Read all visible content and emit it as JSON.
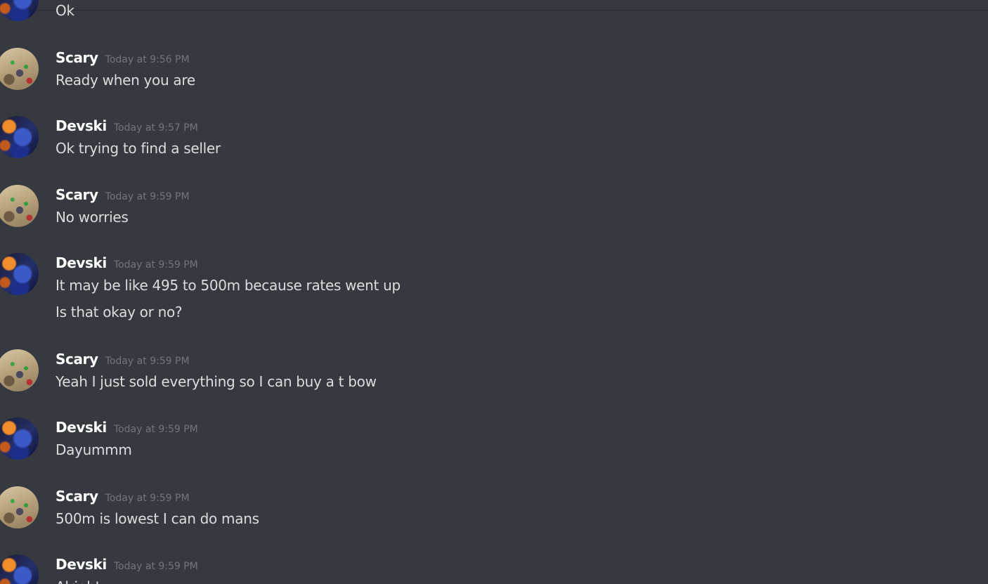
{
  "top_partial": {
    "text": "Ok"
  },
  "messages": [
    {
      "author": "Scary",
      "time": "Today at 9:56 PM",
      "lines": [
        "Ready when you are"
      ]
    },
    {
      "author": "Devski",
      "time": "Today at 9:57 PM",
      "lines": [
        "Ok trying to find a seller"
      ]
    },
    {
      "author": "Scary",
      "time": "Today at 9:59 PM",
      "lines": [
        "No worries"
      ]
    },
    {
      "author": "Devski",
      "time": "Today at 9:59 PM",
      "lines": [
        "It may be like 495 to 500m because rates went up",
        "Is that okay or no?"
      ]
    },
    {
      "author": "Scary",
      "time": "Today at 9:59 PM",
      "lines": [
        "Yeah I just sold everything so I can buy a t bow"
      ]
    },
    {
      "author": "Devski",
      "time": "Today at 9:59 PM",
      "lines": [
        "Dayummm"
      ]
    },
    {
      "author": "Scary",
      "time": "Today at 9:59 PM",
      "lines": [
        "500m is lowest I can do mans"
      ]
    },
    {
      "author": "Devski",
      "time": "Today at 9:59 PM",
      "lines": [
        "Alright"
      ]
    }
  ]
}
